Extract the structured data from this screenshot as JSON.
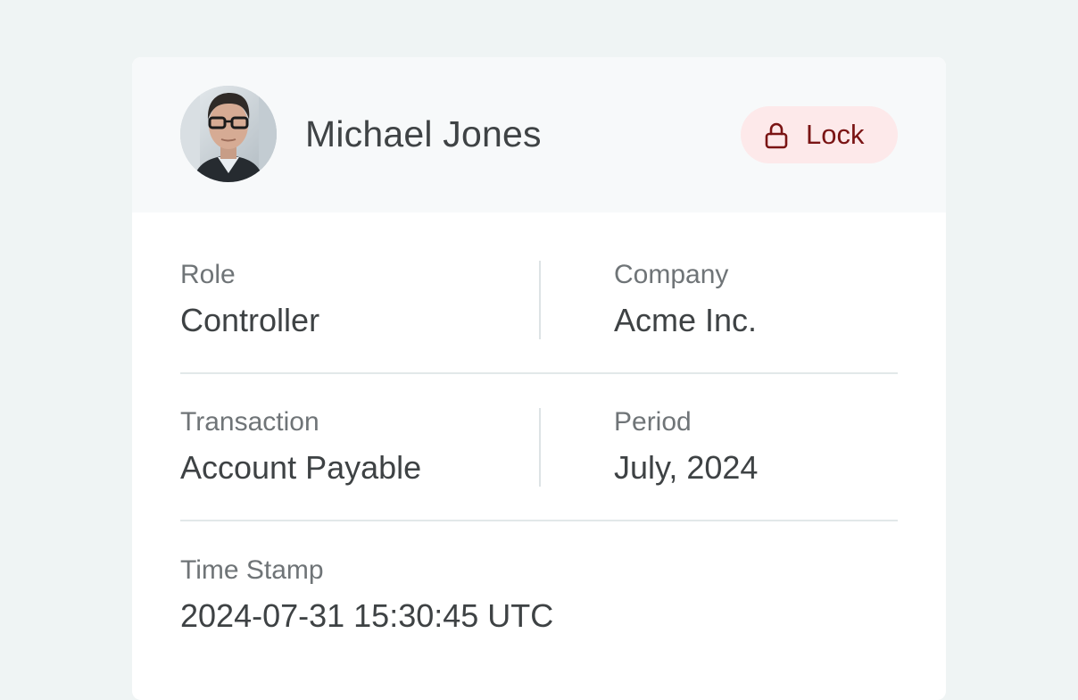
{
  "user": {
    "name": "Michael Jones",
    "avatar_icon": "person-photo"
  },
  "lock_button": {
    "label": "Lock",
    "icon": "lock-icon",
    "accent": "#7a1414",
    "background": "#fde9ea"
  },
  "details": {
    "role": {
      "label": "Role",
      "value": "Controller"
    },
    "company": {
      "label": "Company",
      "value": "Acme Inc."
    },
    "transaction": {
      "label": "Transaction",
      "value": "Account Payable"
    },
    "period": {
      "label": "Period",
      "value": "July, 2024"
    },
    "timestamp": {
      "label": "Time Stamp",
      "value": "2024-07-31 15:30:45 UTC"
    }
  }
}
